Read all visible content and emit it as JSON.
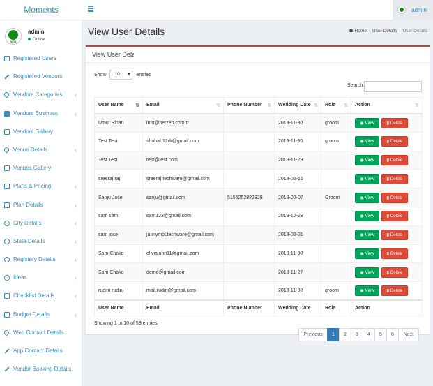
{
  "header": {
    "brand": "Moments",
    "user": "admin"
  },
  "sidebar": {
    "user": {
      "name": "admin",
      "status": "Online",
      "avatar_text": "VEG"
    },
    "items": [
      {
        "label": "Registered Users",
        "icon": "image-icon",
        "chev": false
      },
      {
        "label": "Registered Vendors",
        "icon": "wrench-icon",
        "chev": false
      },
      {
        "label": "Vendors Categories",
        "icon": "map-pin-icon",
        "chev": true
      },
      {
        "label": "Vendors Business",
        "icon": "briefcase-icon",
        "chev": true
      },
      {
        "label": "Vendors Gallery",
        "icon": "image-icon",
        "chev": false
      },
      {
        "label": "Venue Details",
        "icon": "map-pin-icon",
        "chev": true
      },
      {
        "label": "Venues Gallery",
        "icon": "image-icon",
        "chev": false
      },
      {
        "label": "Plans & Pricing",
        "icon": "money-icon",
        "chev": true
      },
      {
        "label": "Plan Details",
        "icon": "money-icon",
        "chev": true
      },
      {
        "label": "City Details",
        "icon": "globe-icon",
        "chev": true
      },
      {
        "label": "State Details",
        "icon": "globe-icon",
        "chev": true
      },
      {
        "label": "Registery Details",
        "icon": "registered-icon",
        "chev": true
      },
      {
        "label": "Ideas",
        "icon": "lightbulb-icon",
        "chev": true
      },
      {
        "label": "Checklist Details",
        "icon": "list-icon",
        "chev": true
      },
      {
        "label": "Budget Details",
        "icon": "money-icon",
        "chev": true
      },
      {
        "label": "Web Contact Details",
        "icon": "map-pin-icon",
        "chev": false
      },
      {
        "label": "App Contact Details",
        "icon": "wrench-icon",
        "chev": false
      },
      {
        "label": "Vendor Booking Details",
        "icon": "wrench-icon",
        "chev": false
      }
    ]
  },
  "page": {
    "title": "View User Details",
    "breadcrumb": [
      "Home",
      "User Details",
      "User Details"
    ]
  },
  "box": {
    "title": "View User Deta",
    "show_label": "Show",
    "entries_value": "10",
    "entries_label": "entries",
    "search_label": "Search:",
    "columns": [
      "User Name",
      "Email",
      "Phone Number",
      "Wedding Date",
      "Role",
      "Action"
    ],
    "rows": [
      {
        "name": "Umut Sinan",
        "email": "info@netzen.com.tr",
        "phone": "",
        "date": "2018-11-30",
        "role": "groom"
      },
      {
        "name": "Test Test",
        "email": "shahab12rk@gmail.com",
        "phone": "",
        "date": "2018-11-30",
        "role": "groom"
      },
      {
        "name": "Test Test",
        "email": "test@test.com",
        "phone": "",
        "date": "2018-11-29",
        "role": ""
      },
      {
        "name": "sreeraj raj",
        "email": "sreeraj.techware@gmail.com",
        "phone": "",
        "date": "2018-02-16",
        "role": ""
      },
      {
        "name": "Sanju Jose",
        "email": "sanju@gmail.com",
        "phone": "5155252882828",
        "date": "2018-02-07",
        "role": "Groom"
      },
      {
        "name": "sam sam",
        "email": "sam123@gmail.com",
        "phone": "",
        "date": "2018-12-28",
        "role": ""
      },
      {
        "name": "sam jose",
        "email": "ja.inymol.techware@gmail.com",
        "phone": "",
        "date": "2018-02-21",
        "role": ""
      },
      {
        "name": "Sam Chako",
        "email": "oliviajohn11@gmail.com",
        "phone": "",
        "date": "2018-11-30",
        "role": ""
      },
      {
        "name": "Sam Chako",
        "email": "demo@gmail.com",
        "phone": "",
        "date": "2018-11-27",
        "role": ""
      },
      {
        "name": "rudini rudini",
        "email": "mail.rudini@gmail.com",
        "phone": "",
        "date": "2018-11-30",
        "role": "groom"
      }
    ],
    "view_label": "View",
    "delete_label": "Delete",
    "info": "Showing 1 to 10 of 58 entries",
    "pagination": {
      "prev": "Previous",
      "pages": [
        "1",
        "2",
        "3",
        "4",
        "5",
        "6"
      ],
      "next": "Next",
      "active": "1"
    }
  },
  "colors": {
    "accent": "#3c8dbc",
    "box_border": "#d73925",
    "view": "#00a65a",
    "delete": "#dd4b39",
    "page_active": "#337ab7"
  }
}
